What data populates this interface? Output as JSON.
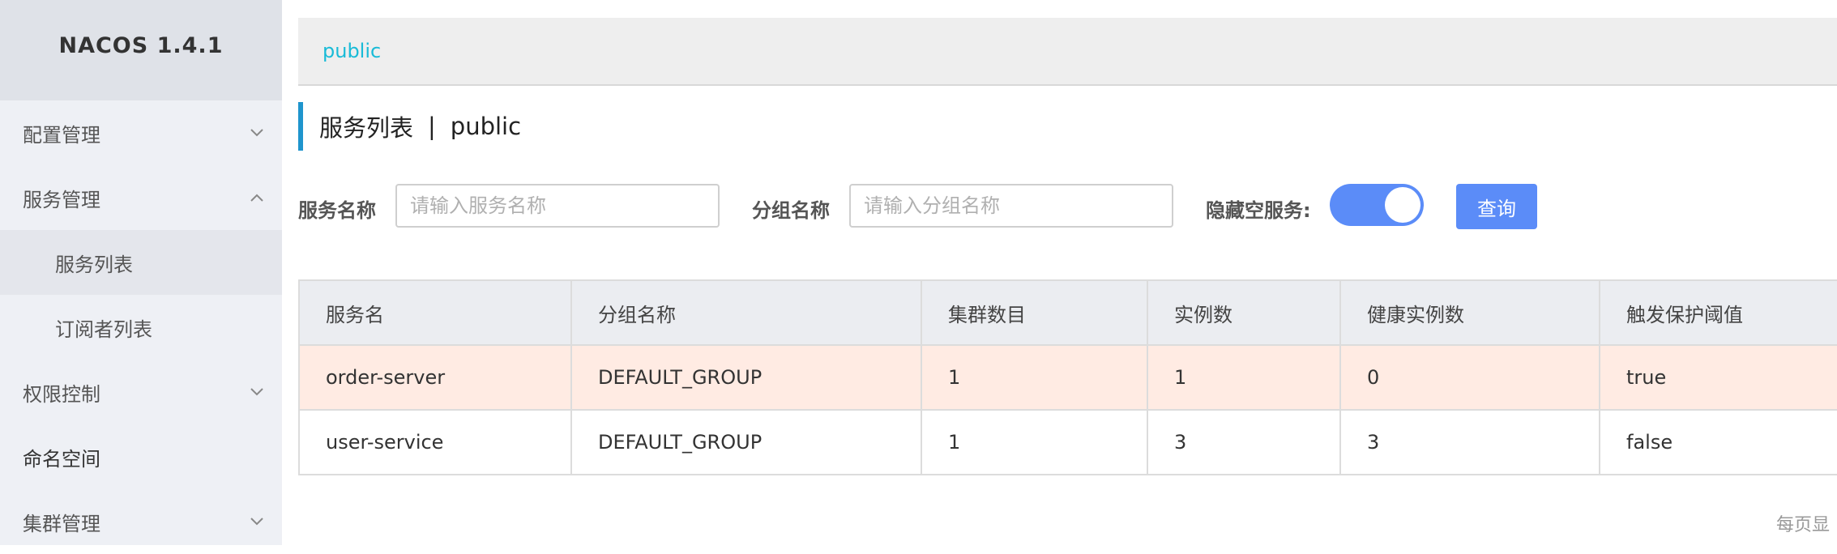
{
  "app": {
    "title": "NACOS 1.4.1"
  },
  "sidebar": {
    "items": [
      {
        "label": "配置管理",
        "chevron": "down"
      },
      {
        "label": "服务管理",
        "chevron": "up"
      },
      {
        "label": "服务列表",
        "chevron": null
      },
      {
        "label": "订阅者列表",
        "chevron": null
      },
      {
        "label": "权限控制",
        "chevron": "down"
      },
      {
        "label": "命名空间",
        "chevron": null
      },
      {
        "label": "集群管理",
        "chevron": "down"
      }
    ]
  },
  "header": {
    "namespace_tab": "public"
  },
  "page": {
    "title": "服务列表",
    "separator": "|",
    "namespace": "public"
  },
  "filters": {
    "service_name_label": "服务名称",
    "service_name_placeholder": "请输入服务名称",
    "group_name_label": "分组名称",
    "group_name_placeholder": "请输入分组名称",
    "hide_empty_label": "隐藏空服务:",
    "hide_empty_value": true,
    "query_label": "查询"
  },
  "table": {
    "columns": [
      "服务名",
      "分组名称",
      "集群数目",
      "实例数",
      "健康实例数",
      "触发保护阈值"
    ],
    "rows": [
      [
        "order-server",
        "DEFAULT_GROUP",
        "1",
        "1",
        "0",
        "true"
      ],
      [
        "user-service",
        "DEFAULT_GROUP",
        "1",
        "3",
        "3",
        "false"
      ]
    ]
  },
  "pagination": {
    "page_size_label": "每页显"
  },
  "colors": {
    "accent": "#5b8cf8",
    "link": "#19bbd7",
    "highlight_row": "#ffebe3",
    "title_bar": "#1f95cd"
  }
}
